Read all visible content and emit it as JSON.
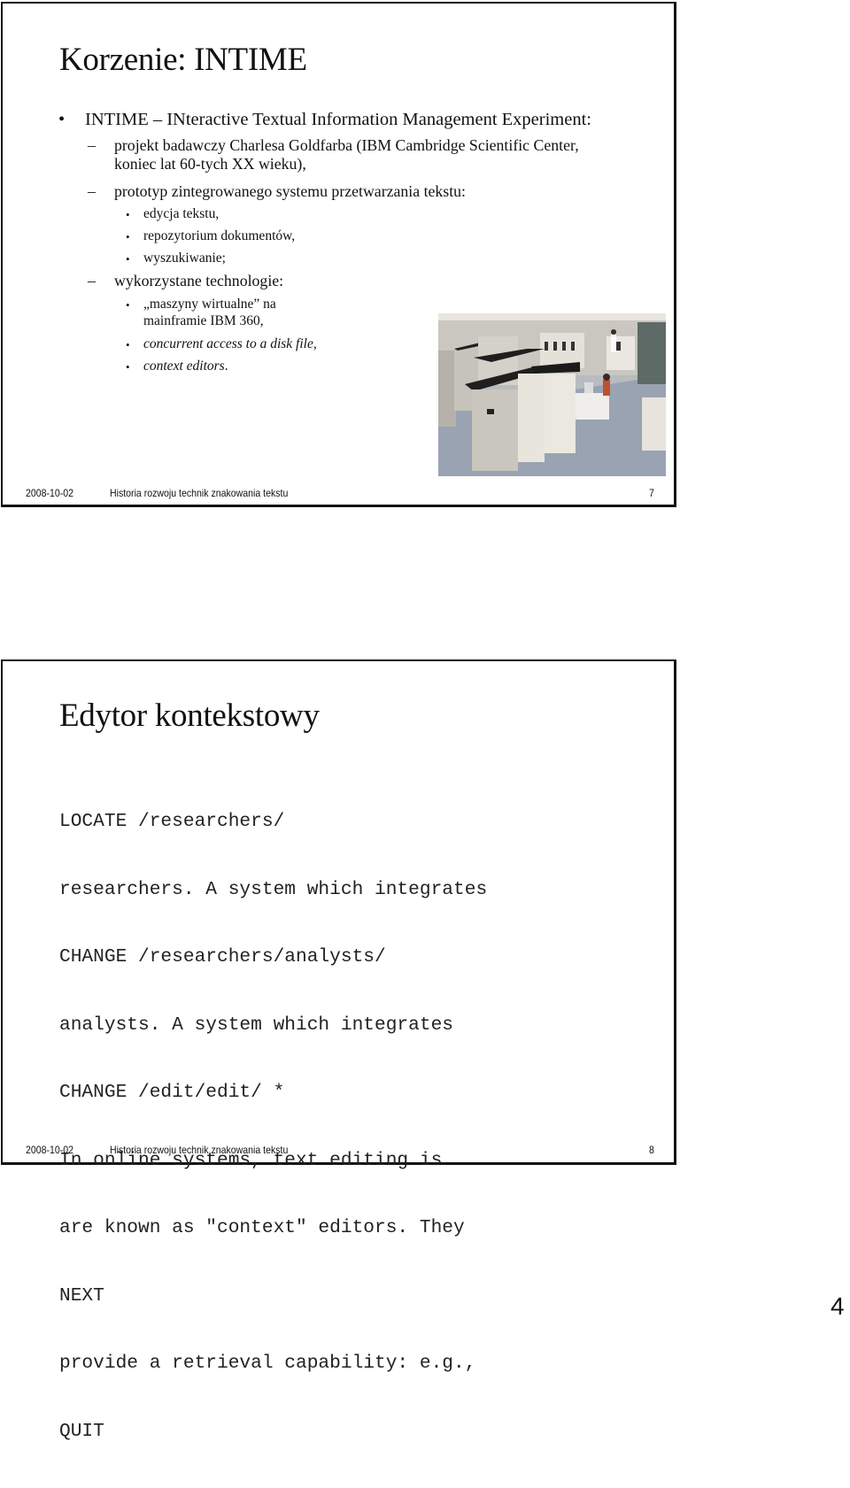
{
  "slides": [
    {
      "title": "Korzenie: INTIME",
      "items": {
        "main": "INTIME – INteractive Textual Information Management Experiment:",
        "sub1_line1": "projekt badawczy Charlesa Goldfarba (IBM Cambridge Scientific Center,",
        "sub1_line2": "koniec lat 60-tych XX wieku),",
        "sub2": "prototyp zintegrowanego systemu przetwarzania tekstu:",
        "sub2_items": [
          "edycja tekstu,",
          "repozytorium dokumentów,",
          "wyszukiwanie;"
        ],
        "sub3": "wykorzystane technologie:",
        "sub3_item1_line1": "„maszyny wirtualne” na",
        "sub3_item1_line2": "mainframie IBM 360,",
        "sub3_item2": "concurrent access to a disk file",
        "sub3_item3": "context editors",
        "comma": ",",
        "period": "."
      },
      "image_alt": "IBM 360 mainframe computer room",
      "footer": {
        "date": "2008-10-02",
        "title": "Historia rozwoju technik znakowania tekstu",
        "number": "7"
      }
    },
    {
      "title": "Edytor kontekstowy",
      "code_lines": [
        "LOCATE /researchers/",
        "researchers. A system which integrates",
        "CHANGE /researchers/analysts/",
        "analysts. A system which integrates",
        "CHANGE /edit/edit/ *",
        "In online systems, text editing is",
        "are known as \"context\" editors. They",
        "NEXT",
        "provide a retrieval capability: e.g.,",
        "QUIT"
      ],
      "footer": {
        "date": "2008-10-02",
        "title": "Historia rozwoju technik znakowania tekstu",
        "number": "8"
      }
    }
  ],
  "symbols": {
    "bullet": "•",
    "dash": "–"
  },
  "page_number": "4"
}
